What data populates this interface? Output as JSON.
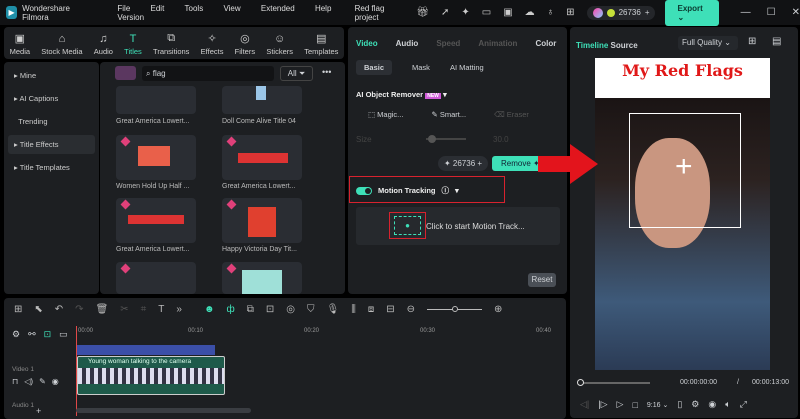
{
  "titlebar": {
    "app": "Wondershare Filmora",
    "menu": [
      "File",
      "Edit",
      "Tools",
      "View",
      "Extended",
      "Help",
      "Version"
    ],
    "project": "Red flag project",
    "credits": "26736",
    "export": "Export"
  },
  "media_tabs": [
    {
      "label": "Media",
      "icon": "▣"
    },
    {
      "label": "Stock Media",
      "icon": "⌂"
    },
    {
      "label": "Audio",
      "icon": "♫"
    },
    {
      "label": "Titles",
      "icon": "T"
    },
    {
      "label": "Transitions",
      "icon": "⧉"
    },
    {
      "label": "Effects",
      "icon": "✧"
    },
    {
      "label": "Filters",
      "icon": "◎"
    },
    {
      "label": "Stickers",
      "icon": "☺"
    },
    {
      "label": "Templates",
      "icon": "▤"
    }
  ],
  "sidebar": [
    "Mine",
    "AI Captions",
    "Trending",
    "Title Effects",
    "Title Templates"
  ],
  "search": {
    "value": "flag",
    "filter": "All"
  },
  "titles": [
    "Great America Lowert...",
    "Doll Come Alive Title 04",
    "Women Hold Up Half ...",
    "Great America Lowert...",
    "Great America Lowert...",
    "Happy Victoria Day Tit..."
  ],
  "props": {
    "tabs": [
      "Video",
      "Audio",
      "Speed",
      "Animation",
      "Color"
    ],
    "subtabs": [
      "Basic",
      "Mask",
      "AI Matting"
    ],
    "remover": "AI Object Remover",
    "new": "NEW",
    "tools": [
      "Magic...",
      "Smart...",
      "Eraser"
    ],
    "size_label": "Size",
    "size_value": "30.0",
    "credits": "26736",
    "remove": "Remove",
    "motion": "Motion Tracking",
    "motion_hint": "Click to start Motion Track...",
    "reset": "Reset"
  },
  "preview": {
    "tabs": [
      "Timeline",
      "Source"
    ],
    "quality": "Full Quality",
    "video_title": "My Red Flags",
    "current": "00:00:00:00",
    "sep": "/",
    "total": "00:00:13:00",
    "ratio": "9:16"
  },
  "timeline": {
    "ruler": [
      "00:00",
      "00:10",
      "00:20",
      "00:30",
      "00:40"
    ],
    "clip": "Young woman talking to the camera",
    "tracks": [
      "Video 1",
      "Audio 1"
    ]
  }
}
